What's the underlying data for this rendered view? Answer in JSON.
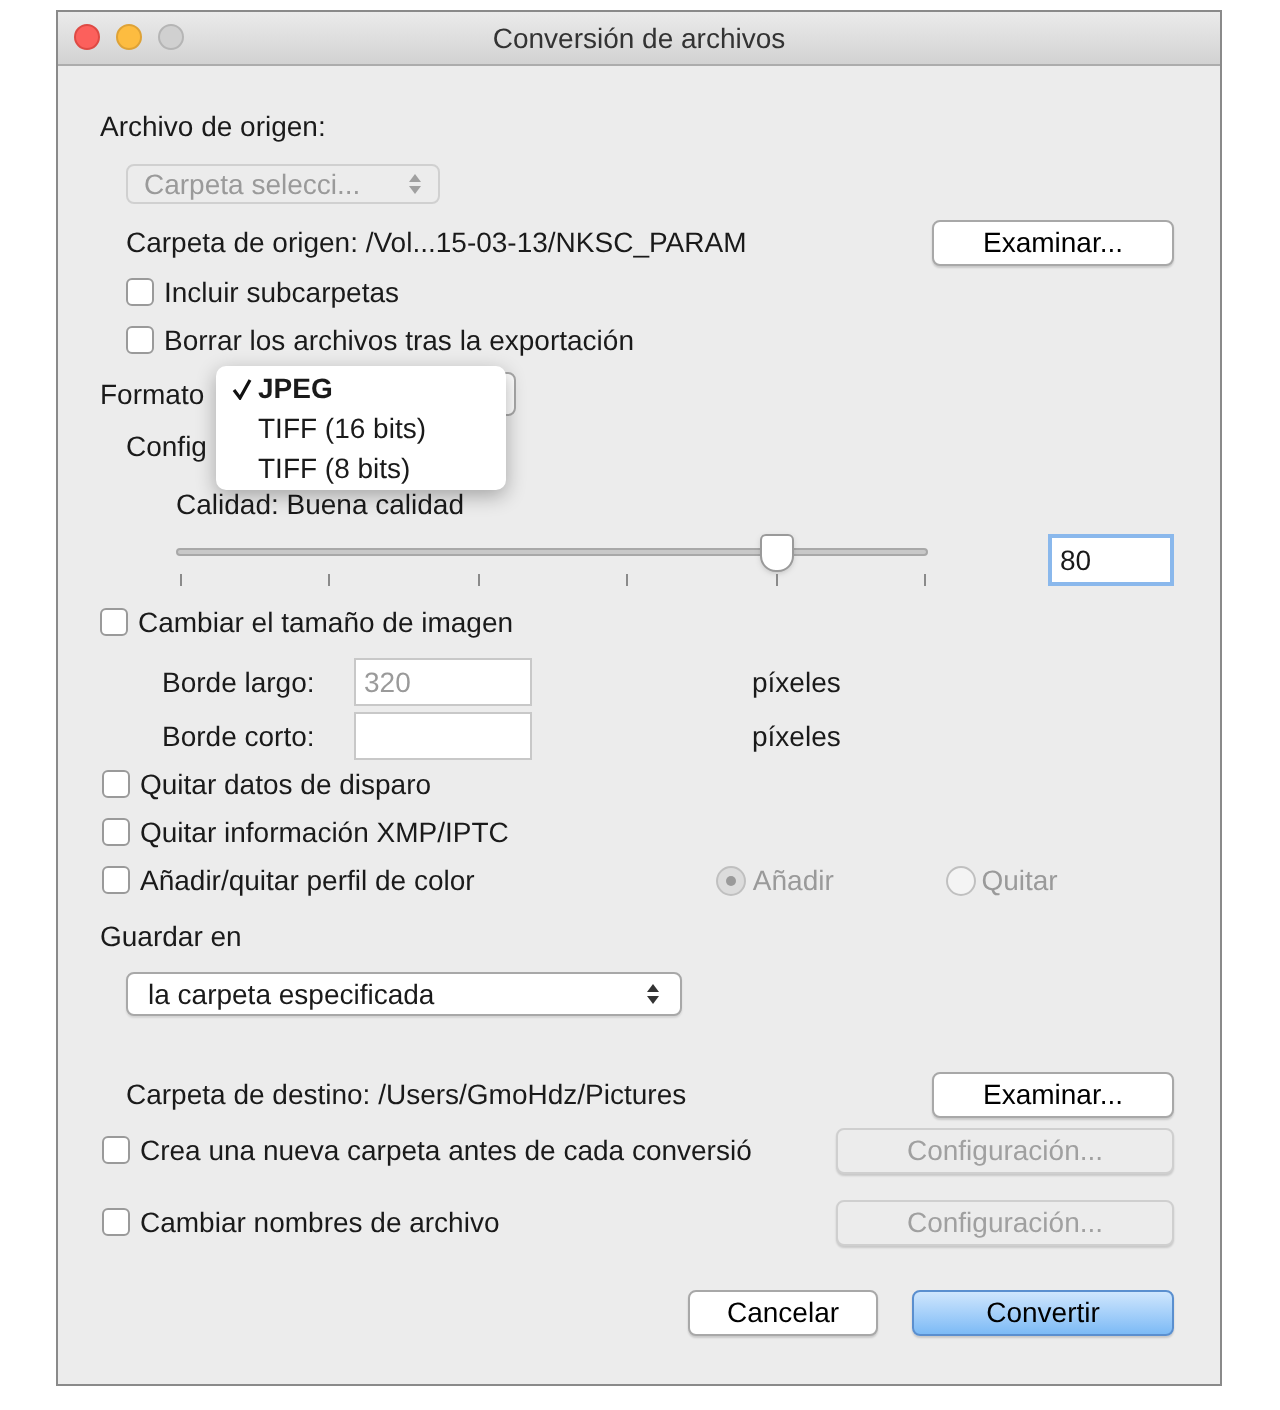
{
  "window": {
    "title": "Conversión de archivos"
  },
  "source": {
    "label": "Archivo de origen:",
    "popup": {
      "value": "Carpeta selecci...",
      "disabled": true
    },
    "folder_text": "Carpeta de origen: /Vol...15-03-13/NKSC_PARAM",
    "browse_button": "Examinar...",
    "options": [
      {
        "label": "Incluir subcarpetas",
        "checked": false
      },
      {
        "label": "Borrar los archivos tras la exportación",
        "checked": false
      }
    ]
  },
  "format": {
    "label": "Formato",
    "menu": [
      {
        "label": "JPEG",
        "selected": true
      },
      {
        "label": "TIFF (16 bits)",
        "selected": false
      },
      {
        "label": "TIFF (8 bits)",
        "selected": false
      }
    ]
  },
  "config_label": "Config",
  "quality": {
    "label": "Calidad: Buena calidad",
    "level": 0.8,
    "value": "80"
  },
  "resize": {
    "label": "Cambiar el tamaño de imagen",
    "checked": false,
    "fields": [
      {
        "label": "Borde largo:",
        "placeholder": "320",
        "unit": "píxeles"
      },
      {
        "label": "Borde corto:",
        "unit": "píxeles"
      }
    ]
  },
  "metadata_options": [
    {
      "label": "Quitar datos de disparo",
      "checked": false
    },
    {
      "label": "Quitar información XMP/IPTC",
      "checked": false
    },
    {
      "label": "Añadir/quitar perfil de color",
      "checked": false
    }
  ],
  "color_profile_radios": [
    {
      "label": "Añadir",
      "selected": true,
      "disabled": true
    },
    {
      "label": "Quitar",
      "selected": false,
      "disabled": true
    }
  ],
  "save": {
    "label": "Guardar en",
    "popup": "la carpeta especificada",
    "destination_text": "Carpeta de destino: /Users/GmoHdz/Pictures",
    "browse_button": "Examinar...",
    "options": [
      {
        "label": "Crea una nueva carpeta antes de cada conversió",
        "checked": false,
        "button": "Configuración...",
        "button_disabled": true
      },
      {
        "label": "Cambiar nombres de archivo",
        "checked": false,
        "button": "Configuración...",
        "button_disabled": true
      }
    ]
  },
  "buttons": [
    {
      "label": "Cancelar",
      "default": false
    },
    {
      "label": "Convertir",
      "default": true
    }
  ]
}
